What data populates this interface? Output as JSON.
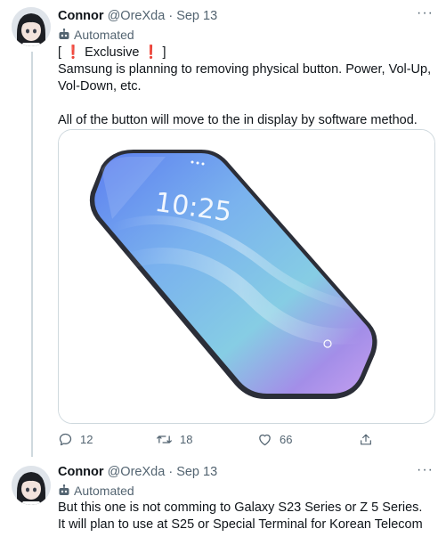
{
  "tweets": [
    {
      "author": {
        "name": "Connor",
        "handle": "@OreXda",
        "separator": "·",
        "date": "Sep 13",
        "label": "Automated"
      },
      "body": {
        "line1_open": "[",
        "line1_mark": "❗",
        "line1_text": "Exclusive",
        "line1_close": "]",
        "paragraph1": "Samsung is planning to removing physical button. Power, Vol-Up, Vol-Down, etc.",
        "paragraph2": "All of the button will move to the in display by software method."
      },
      "media": {
        "clock_text": "10:25"
      },
      "stats": {
        "replies": "12",
        "retweets": "18",
        "likes": "66"
      }
    },
    {
      "author": {
        "name": "Connor",
        "handle": "@OreXda",
        "separator": "·",
        "date": "Sep 13",
        "label": "Automated"
      },
      "body": {
        "paragraph1": "But this one is not comming to Galaxy S23 Series or Z 5 Series. It will plan to use at S25 or Special Terminal for Korean Telecom"
      }
    }
  ],
  "colors": {
    "text": "#0f1419",
    "secondary": "#536471",
    "accent_red": "#e0245e",
    "border": "#cfd9de"
  }
}
